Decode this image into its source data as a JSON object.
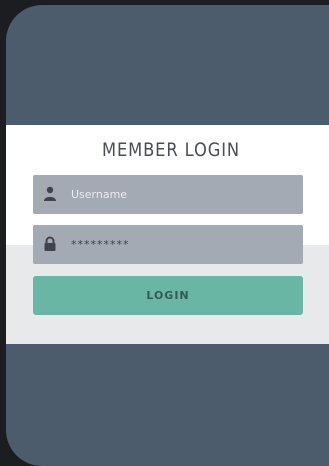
{
  "form": {
    "title": "MEMBER LOGIN",
    "username": {
      "placeholder": "Username",
      "icon": "user-icon"
    },
    "password": {
      "value": "*********",
      "icon": "lock-icon"
    },
    "login_label": "LOGIN"
  },
  "colors": {
    "background": "#4c5c6c",
    "field": "#a3aab3",
    "button": "#6ab6a4"
  }
}
